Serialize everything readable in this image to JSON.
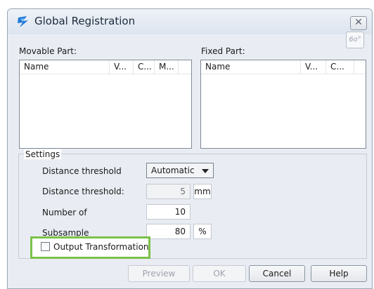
{
  "window": {
    "title": "Global Registration",
    "close_glyph": "✕"
  },
  "movable": {
    "label": "Movable Part:",
    "columns": [
      "Name",
      "V...",
      "C...",
      "M..."
    ]
  },
  "fixed": {
    "label": "Fixed Part:",
    "columns": [
      "Name",
      "V...",
      "C..."
    ],
    "view_button_glyph": "6o°"
  },
  "settings": {
    "group_label": "Settings",
    "rows": [
      {
        "label": "Distance threshold",
        "value": "Automatic"
      },
      {
        "label": "Distance threshold:",
        "value": "5",
        "unit": "mm"
      },
      {
        "label": "Number of",
        "value": "10"
      },
      {
        "label": "Subsample",
        "value": "80",
        "unit": "%"
      }
    ],
    "output_transformation_label": "Output Transformation",
    "output_transformation_checked": false
  },
  "buttons": {
    "preview": "Preview",
    "ok": "OK",
    "cancel": "Cancel",
    "help": "Help"
  },
  "colors": {
    "highlight": "#7cc24a",
    "app_icon_blue": "#1f7ad6"
  }
}
